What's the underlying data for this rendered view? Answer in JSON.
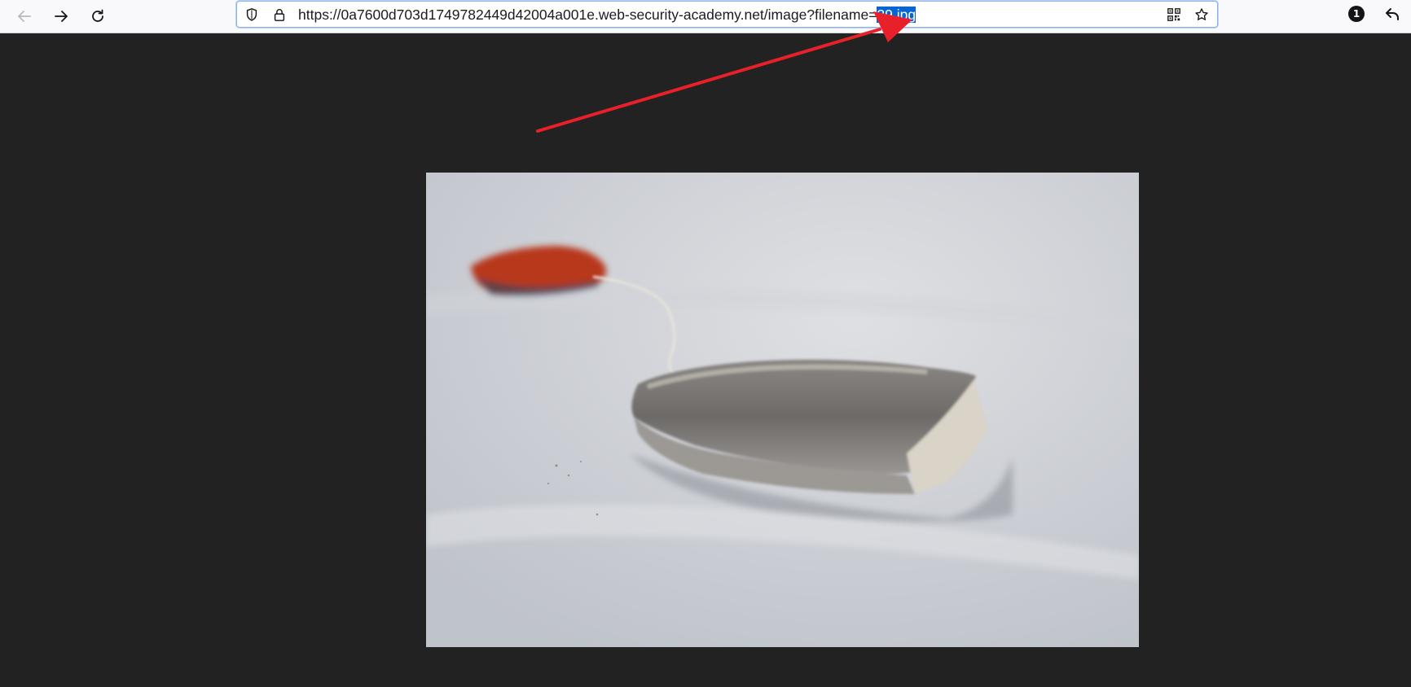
{
  "browser": {
    "url_prefix": "https://0a7600d703d1749782449d42004a001e.web-security-academy.net/image?filename=",
    "url_selected": "29.jpg",
    "icons": {
      "back": "arrow-left-icon",
      "forward": "arrow-right-icon",
      "reload": "reload-icon",
      "tracking_protection": "shield-icon",
      "site_security": "lock-icon",
      "qr": "qr-code-icon",
      "bookmark": "star-icon",
      "undo": "undo-arrow-icon"
    },
    "extension_badge": "1"
  },
  "image": {
    "subject": "tea-bag"
  },
  "colors": {
    "background": "#222222",
    "toolbar": "#f9f9fb",
    "selection": "#0a64d4",
    "annotation_arrow": "#e8202a"
  }
}
